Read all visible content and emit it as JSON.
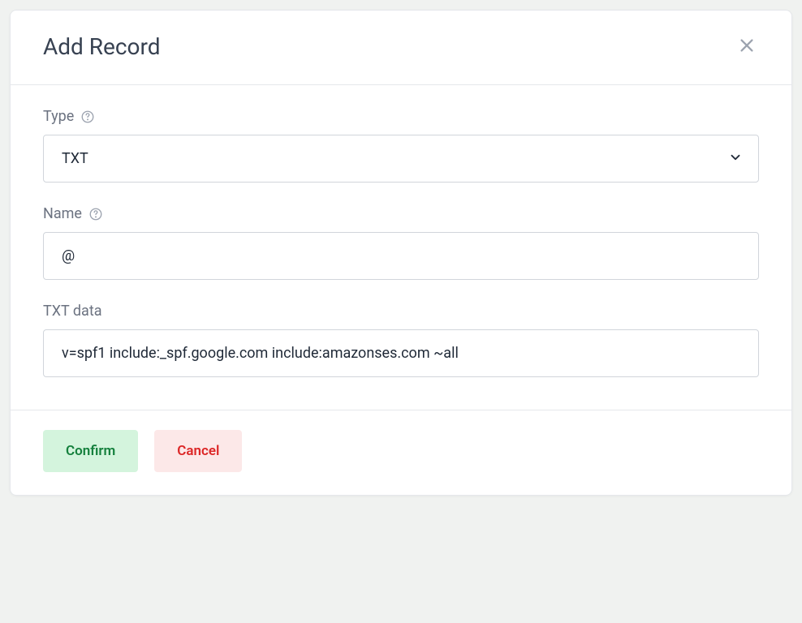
{
  "modal": {
    "title": "Add Record",
    "fields": {
      "type": {
        "label": "Type",
        "value": "TXT"
      },
      "name": {
        "label": "Name",
        "value": "@"
      },
      "txtdata": {
        "label": "TXT data",
        "value": "v=spf1 include:_spf.google.com include:amazonses.com ~all"
      }
    },
    "buttons": {
      "confirm": "Confirm",
      "cancel": "Cancel"
    }
  }
}
